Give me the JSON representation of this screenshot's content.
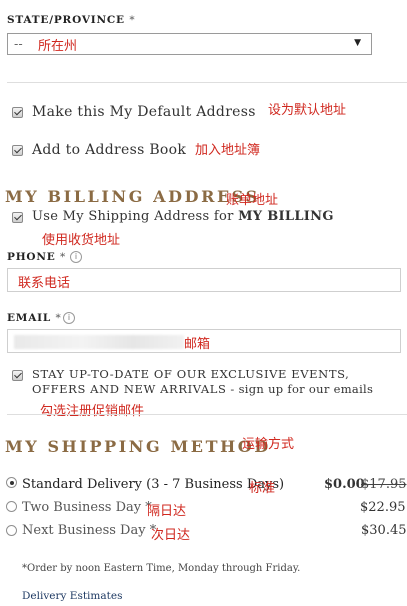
{
  "state": {
    "label": "STATE/PROVINCE",
    "required": "*",
    "placeholder": "--",
    "annotation": "所在州"
  },
  "default_address": {
    "label": "Make this My Default Address",
    "annotation": "设为默认地址"
  },
  "address_book": {
    "label": "Add to Address Book",
    "annotation": "加入地址簿"
  },
  "billing": {
    "title": "MY BILLING ADDRESS",
    "annotation": "账单地址",
    "use_shipping_prefix": "Use My Shipping Address for ",
    "use_shipping_bold": "MY BILLING",
    "use_shipping_annotation": "使用收货地址"
  },
  "phone": {
    "label": "PHONE",
    "required": "*",
    "info": "i",
    "annotation": "联系电话"
  },
  "email": {
    "label": "EMAIL",
    "required": "*",
    "info": "i",
    "annotation": "邮箱"
  },
  "newsletter": {
    "line1": "STAY UP-TO-DATE OF OUR EXCLUSIVE EVENTS,",
    "line2_caps": "OFFERS AND NEW ARRIVALS",
    "line2_rest": " - sign up for our emails",
    "annotation": "勾选注册促销邮件"
  },
  "shipping": {
    "title": "MY SHIPPING METHOD",
    "annotation": "运输方式",
    "options": [
      {
        "label": "Standard Delivery (3 - 7 Business Days)",
        "annotation": "标准",
        "price": "$0.00",
        "old_price": "$17.95",
        "selected": true
      },
      {
        "label": "Two Business Day *",
        "annotation": "隔日达",
        "price": "$22.95",
        "selected": false
      },
      {
        "label": "Next Business Day *",
        "annotation": "次日达",
        "price": "$30.45",
        "selected": false
      }
    ],
    "footnote": "*Order by noon Eastern Time, Monday through Friday.",
    "estimates_link": "Delivery Estimates"
  },
  "colors": {
    "accent_title": "#8b6b44",
    "annotation_red": "#d0281f",
    "link": "#1f3a63"
  }
}
